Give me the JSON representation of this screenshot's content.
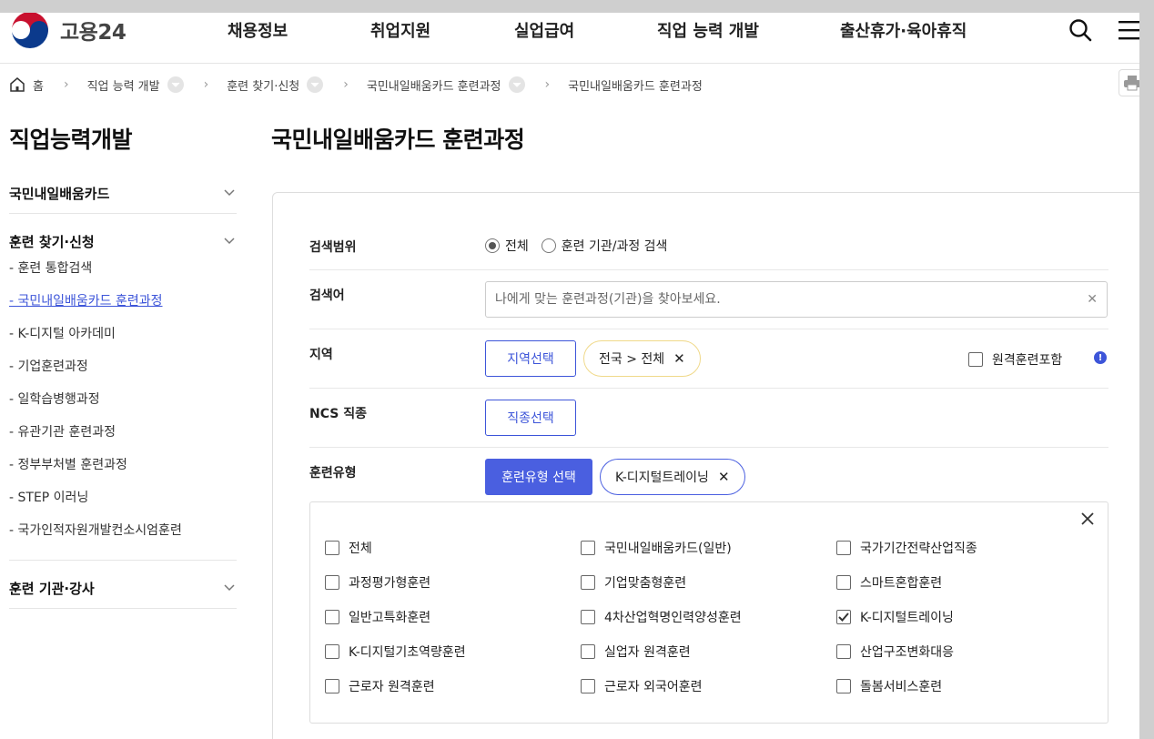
{
  "header": {
    "logo_text": "고용24",
    "nav": [
      "채용정보",
      "취업지원",
      "실업급여",
      "직업 능력 개발",
      "출산휴가·육아휴직"
    ],
    "search_icon": "search-icon",
    "menu_icon": "hamburger-menu-icon"
  },
  "breadcrumb": {
    "home": "홈",
    "items": [
      "직업 능력 개발",
      "훈련 찾기·신청",
      "국민내일배움카드 훈련과정",
      "국민내일배움카드 훈련과정"
    ]
  },
  "sidebar": {
    "title": "직업능력개발",
    "sections": [
      {
        "label": "국민내일배움카드",
        "items": []
      },
      {
        "label": "훈련 찾기·신청",
        "items": [
          "- 훈련 통합검색",
          "- 국민내일배움카드 훈련과정",
          "- K-디지털 아카데미",
          "- 기업훈련과정",
          "- 일학습병행과정",
          "- 유관기관 훈련과정",
          "- 정부부처별 훈련과정",
          "- STEP 이러닝",
          "- 국가인적자원개발컨소시엄훈련"
        ]
      },
      {
        "label": "훈련 기관·강사",
        "items": []
      }
    ],
    "active_item": "- 국민내일배움카드 훈련과정"
  },
  "main": {
    "title": "국민내일배움카드 훈련과정",
    "search_scope": {
      "label": "검색범위",
      "options": [
        "전체",
        "훈련 기관/과정 검색"
      ],
      "selected": "전체"
    },
    "keyword": {
      "label": "검색어",
      "placeholder": "나에게 맞는 훈련과정(기관)을 찾아보세요.",
      "value": ""
    },
    "region": {
      "label": "지역",
      "button": "지역선택",
      "chip": "전국 > 전체",
      "remote_label": "원격훈련포함"
    },
    "ncs": {
      "label": "NCS 직종",
      "button": "직종선택"
    },
    "training_type": {
      "label": "훈련유형",
      "button": "훈련유형 선택",
      "chip": "K-디지털트레이닝",
      "options": [
        {
          "label": "전체",
          "checked": false
        },
        {
          "label": "국민내일배움카드(일반)",
          "checked": false
        },
        {
          "label": "국가기간전략산업직종",
          "checked": false
        },
        {
          "label": "과정평가형훈련",
          "checked": false
        },
        {
          "label": "기업맞춤형훈련",
          "checked": false
        },
        {
          "label": "스마트혼합훈련",
          "checked": false
        },
        {
          "label": "일반고특화훈련",
          "checked": false
        },
        {
          "label": "4차산업혁명인력양성훈련",
          "checked": false
        },
        {
          "label": "K-디지털트레이닝",
          "checked": true
        },
        {
          "label": "K-디지털기초역량훈련",
          "checked": false
        },
        {
          "label": "실업자 원격훈련",
          "checked": false
        },
        {
          "label": "산업구조변화대응",
          "checked": false
        },
        {
          "label": "근로자 원격훈련",
          "checked": false
        },
        {
          "label": "근로자 외국어훈련",
          "checked": false
        },
        {
          "label": "돌봄서비스훈련",
          "checked": false
        }
      ]
    }
  },
  "colors": {
    "accent": "#4a5fe0",
    "link_active": "#3d55d9",
    "region_chip_border": "#f0d98a"
  }
}
